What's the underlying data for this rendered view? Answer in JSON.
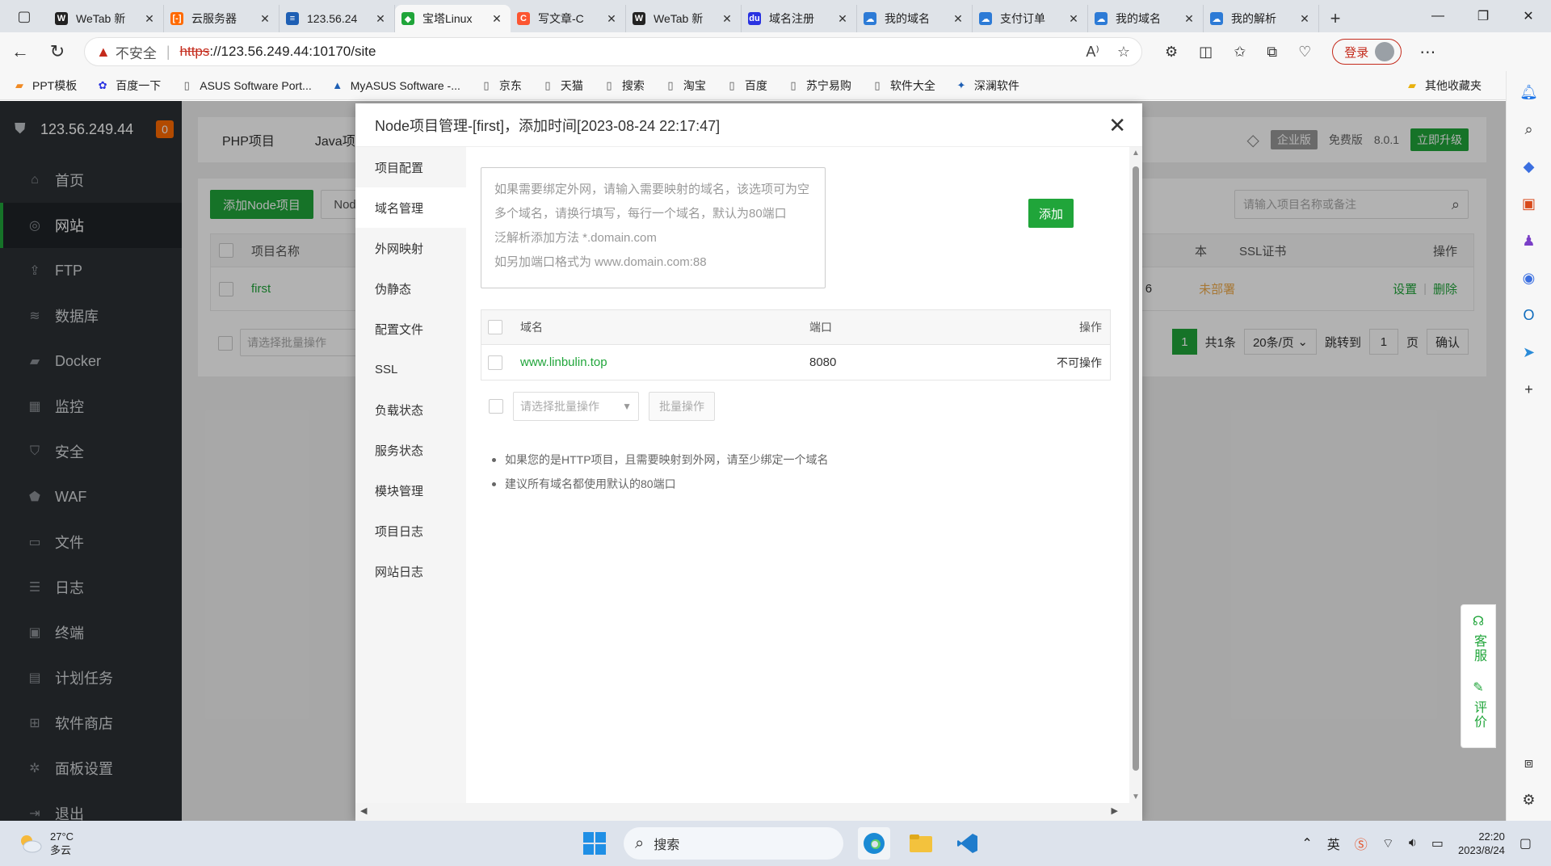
{
  "browser": {
    "tabs": [
      {
        "label": "WeTab 新",
        "color": "#222222",
        "glyph": "W"
      },
      {
        "label": "云服务器",
        "color": "#ff6a00",
        "glyph": "[-]"
      },
      {
        "label": "123.56.24",
        "color": "#1e5fb4",
        "glyph": "≡"
      },
      {
        "label": "宝塔Linux",
        "color": "#20a53a",
        "glyph": "◆",
        "active": true
      },
      {
        "label": "写文章-C",
        "color": "#fc5531",
        "glyph": "C"
      },
      {
        "label": "WeTab 新",
        "color": "#222222",
        "glyph": "W"
      },
      {
        "label": "域名注册",
        "color": "#2932e1",
        "glyph": "du"
      },
      {
        "label": "我的域名",
        "color": "#2d7bd6",
        "glyph": "☁"
      },
      {
        "label": "支付订单",
        "color": "#2d7bd6",
        "glyph": "☁"
      },
      {
        "label": "我的域名",
        "color": "#2d7bd6",
        "glyph": "☁"
      },
      {
        "label": "我的解析",
        "color": "#2d7bd6",
        "glyph": "☁"
      }
    ],
    "url": {
      "insecure_label": "不安全",
      "scheme": "https",
      "rest": "://123.56.249.44:10170/site"
    },
    "login_label": "登录",
    "bookmarks": [
      "PPT模板",
      "百度一下",
      "ASUS Software Port...",
      "MyASUS Software -...",
      "京东",
      "天猫",
      "搜索",
      "淘宝",
      "百度",
      "苏宁易购",
      "软件大全",
      "深澜软件"
    ],
    "other_bookmarks": "其他收藏夹"
  },
  "panel": {
    "server_ip": "123.56.249.44",
    "badge_count": "0",
    "menu": [
      {
        "label": "首页",
        "icon": "home-icon",
        "glyph": "⌂"
      },
      {
        "label": "网站",
        "icon": "globe-icon",
        "glyph": "◎",
        "active": true
      },
      {
        "label": "FTP",
        "icon": "ftp-icon",
        "glyph": "⇪"
      },
      {
        "label": "数据库",
        "icon": "database-icon",
        "glyph": "≋"
      },
      {
        "label": "Docker",
        "icon": "docker-icon",
        "glyph": "▰"
      },
      {
        "label": "监控",
        "icon": "monitor-icon",
        "glyph": "▦"
      },
      {
        "label": "安全",
        "icon": "shield-icon",
        "glyph": "⛉"
      },
      {
        "label": "WAF",
        "icon": "waf-icon",
        "glyph": "⬟"
      },
      {
        "label": "文件",
        "icon": "folder-icon",
        "glyph": "▭"
      },
      {
        "label": "日志",
        "icon": "log-icon",
        "glyph": "☰"
      },
      {
        "label": "终端",
        "icon": "terminal-icon",
        "glyph": "▣"
      },
      {
        "label": "计划任务",
        "icon": "calendar-icon",
        "glyph": "▤"
      },
      {
        "label": "软件商店",
        "icon": "apps-icon",
        "glyph": "⊞"
      },
      {
        "label": "面板设置",
        "icon": "gear-icon",
        "glyph": "✲"
      },
      {
        "label": "退出",
        "icon": "logout-icon",
        "glyph": "⇥"
      }
    ],
    "tabs": [
      "PHP项目",
      "Java项"
    ],
    "edition": {
      "enterprise": "企业版",
      "free": "免费版",
      "version": "8.0.1",
      "upgrade": "立即升级"
    },
    "add_node_label": "添加Node项目",
    "node_btn_label": "Nod",
    "search_placeholder": "请输入项目名称或备注",
    "table": {
      "col_name": "项目名称",
      "col_version_tail": "本",
      "col_ssl": "SSL证书",
      "col_ops": "操作",
      "row": {
        "name": "first",
        "version_tail": "6",
        "ssl": "未部署",
        "settings": "设置",
        "delete": "删除"
      }
    },
    "batch_placeholder": "请选择批量操作",
    "pager": {
      "current": "1",
      "total": "共1条",
      "per_page": "20条/页",
      "jump": "跳转到",
      "page_input": "1",
      "page_unit": "页",
      "confirm": "确认"
    }
  },
  "modal": {
    "title": "Node项目管理-[first]，添加时间[2023-08-24 22:17:47]",
    "nav": [
      "项目配置",
      "域名管理",
      "外网映射",
      "伪静态",
      "配置文件",
      "SSL",
      "负载状态",
      "服务状态",
      "模块管理",
      "项目日志",
      "网站日志"
    ],
    "active_nav": 1,
    "textarea_hint": [
      "如果需要绑定外网，请输入需要映射的域名，该选项可为空",
      "多个域名，请换行填写，每行一个域名，默认为80端口",
      "泛解析添加方法 *.domain.com",
      "如另加端口格式为 www.domain.com:88"
    ],
    "add_label": "添加",
    "domain_table": {
      "col_domain": "域名",
      "col_port": "端口",
      "col_ops": "操作",
      "rows": [
        {
          "domain": "www.linbulin.top",
          "port": "8080",
          "ops": "不可操作"
        }
      ]
    },
    "batch_placeholder": "请选择批量操作",
    "batch_btn": "批量操作",
    "tips": [
      "如果您的是HTTP项目，且需要映射到外网，请至少绑定一个域名",
      "建议所有域名都使用默认的80端口"
    ]
  },
  "float": {
    "service": "客服",
    "rate": "评价"
  },
  "taskbar": {
    "temp": "27°C",
    "weather": "多云",
    "search_label": "搜索",
    "time": "22:20",
    "date": "2023/8/24"
  },
  "colors": {
    "brand_green": "#20a53a",
    "sidebar_bg": "#2c3034",
    "warning_red": "#c42b1c"
  }
}
